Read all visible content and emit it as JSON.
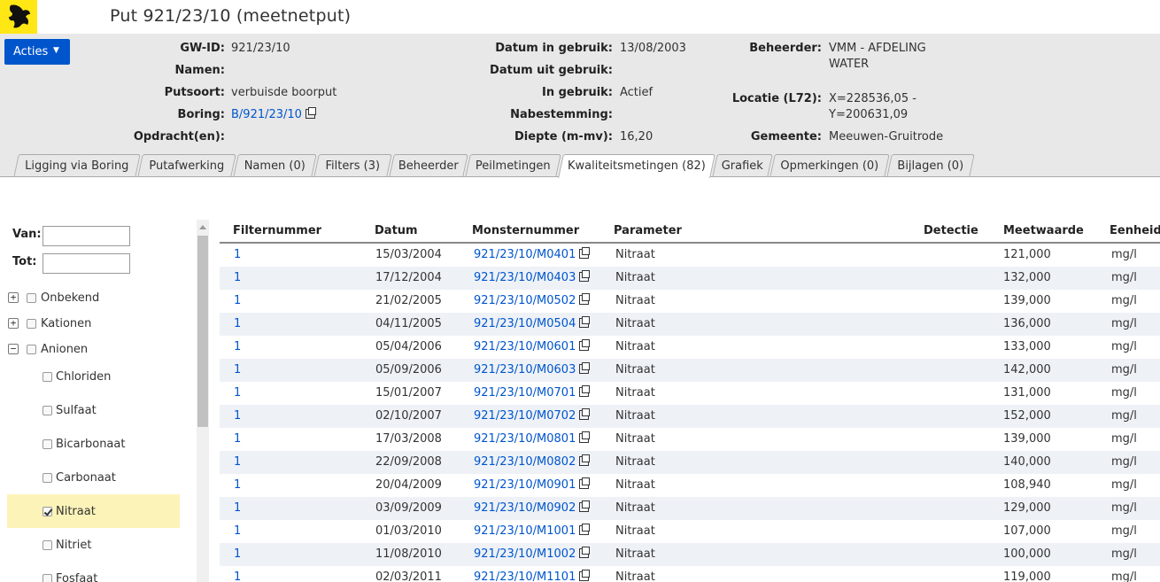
{
  "title": "Put 921/23/10 (meetnetput)",
  "actions_label": "Acties",
  "info": {
    "col1": [
      {
        "label": "GW-ID:",
        "value": "921/23/10"
      },
      {
        "label": "Namen:",
        "value": ""
      },
      {
        "label": "Putsoort:",
        "value": "verbuisde boorput"
      },
      {
        "label": "Boring:",
        "value": "B/921/23/10"
      },
      {
        "label": "Opdracht(en):",
        "value": ""
      }
    ],
    "col2": [
      {
        "label": "Datum in gebruik:",
        "value": "13/08/2003"
      },
      {
        "label": "Datum uit gebruik:",
        "value": ""
      },
      {
        "label": "In gebruik:",
        "value": "Actief"
      },
      {
        "label": "Nabestemming:",
        "value": ""
      },
      {
        "label": "Diepte (m-mv):",
        "value": "16,20"
      }
    ],
    "col3": {
      "beheerder_label": "Beheerder:",
      "beheerder_line1": "VMM - AFDELING",
      "beheerder_line2": "WATER",
      "locatie_label": "Locatie (L72):",
      "locatie_line1": "X=228536,05 -",
      "locatie_line2": "Y=200631,09",
      "gemeente_label": "Gemeente:",
      "gemeente_value": "Meeuwen-Gruitrode"
    }
  },
  "tabs": [
    {
      "label": "Ligging via Boring",
      "active": false
    },
    {
      "label": "Putafwerking",
      "active": false
    },
    {
      "label": "Namen (0)",
      "active": false
    },
    {
      "label": "Filters (3)",
      "active": false
    },
    {
      "label": "Beheerder",
      "active": false
    },
    {
      "label": "Peilmetingen",
      "active": false
    },
    {
      "label": "Kwaliteitsmetingen (82)",
      "active": true
    },
    {
      "label": "Grafiek",
      "active": false
    },
    {
      "label": "Opmerkingen (0)",
      "active": false
    },
    {
      "label": "Bijlagen (0)",
      "active": false
    }
  ],
  "filters": {
    "van_label": "Van:",
    "tot_label": "Tot:",
    "van_value": "",
    "tot_value": "",
    "groups": [
      {
        "label": "Onbekend",
        "expander": "+",
        "checked": false
      },
      {
        "label": "Kationen",
        "expander": "+",
        "checked": false
      },
      {
        "label": "Anionen",
        "expander": "−",
        "checked": false
      }
    ],
    "anionen_children": [
      {
        "label": "Chloriden",
        "checked": false
      },
      {
        "label": "Sulfaat",
        "checked": false
      },
      {
        "label": "Bicarbonaat",
        "checked": false
      },
      {
        "label": "Carbonaat",
        "checked": false
      },
      {
        "label": "Nitraat",
        "checked": true
      },
      {
        "label": "Nitriet",
        "checked": false
      },
      {
        "label": "Fosfaat",
        "checked": false
      }
    ]
  },
  "table": {
    "headers": {
      "filternummer": "Filternummer",
      "datum": "Datum",
      "monsternummer": "Monsternummer",
      "parameter": "Parameter",
      "detectie": "Detectie",
      "meetwaarde": "Meetwaarde",
      "eenheid": "Eenheid"
    },
    "rows": [
      {
        "filter": "1",
        "datum": "15/03/2004",
        "monster": "921/23/10/M0401",
        "parameter": "Nitraat",
        "detectie": "",
        "meetwaarde": "121,000",
        "eenheid": "mg/l"
      },
      {
        "filter": "1",
        "datum": "17/12/2004",
        "monster": "921/23/10/M0403",
        "parameter": "Nitraat",
        "detectie": "",
        "meetwaarde": "132,000",
        "eenheid": "mg/l"
      },
      {
        "filter": "1",
        "datum": "21/02/2005",
        "monster": "921/23/10/M0502",
        "parameter": "Nitraat",
        "detectie": "",
        "meetwaarde": "139,000",
        "eenheid": "mg/l"
      },
      {
        "filter": "1",
        "datum": "04/11/2005",
        "monster": "921/23/10/M0504",
        "parameter": "Nitraat",
        "detectie": "",
        "meetwaarde": "136,000",
        "eenheid": "mg/l"
      },
      {
        "filter": "1",
        "datum": "05/04/2006",
        "monster": "921/23/10/M0601",
        "parameter": "Nitraat",
        "detectie": "",
        "meetwaarde": "133,000",
        "eenheid": "mg/l"
      },
      {
        "filter": "1",
        "datum": "05/09/2006",
        "monster": "921/23/10/M0603",
        "parameter": "Nitraat",
        "detectie": "",
        "meetwaarde": "142,000",
        "eenheid": "mg/l"
      },
      {
        "filter": "1",
        "datum": "15/01/2007",
        "monster": "921/23/10/M0701",
        "parameter": "Nitraat",
        "detectie": "",
        "meetwaarde": "131,000",
        "eenheid": "mg/l"
      },
      {
        "filter": "1",
        "datum": "02/10/2007",
        "monster": "921/23/10/M0702",
        "parameter": "Nitraat",
        "detectie": "",
        "meetwaarde": "152,000",
        "eenheid": "mg/l"
      },
      {
        "filter": "1",
        "datum": "17/03/2008",
        "monster": "921/23/10/M0801",
        "parameter": "Nitraat",
        "detectie": "",
        "meetwaarde": "139,000",
        "eenheid": "mg/l"
      },
      {
        "filter": "1",
        "datum": "22/09/2008",
        "monster": "921/23/10/M0802",
        "parameter": "Nitraat",
        "detectie": "",
        "meetwaarde": "140,000",
        "eenheid": "mg/l"
      },
      {
        "filter": "1",
        "datum": "20/04/2009",
        "monster": "921/23/10/M0901",
        "parameter": "Nitraat",
        "detectie": "",
        "meetwaarde": "108,940",
        "eenheid": "mg/l"
      },
      {
        "filter": "1",
        "datum": "03/09/2009",
        "monster": "921/23/10/M0902",
        "parameter": "Nitraat",
        "detectie": "",
        "meetwaarde": "129,000",
        "eenheid": "mg/l"
      },
      {
        "filter": "1",
        "datum": "01/03/2010",
        "monster": "921/23/10/M1001",
        "parameter": "Nitraat",
        "detectie": "",
        "meetwaarde": "107,000",
        "eenheid": "mg/l"
      },
      {
        "filter": "1",
        "datum": "11/08/2010",
        "monster": "921/23/10/M1002",
        "parameter": "Nitraat",
        "detectie": "",
        "meetwaarde": "100,000",
        "eenheid": "mg/l"
      },
      {
        "filter": "1",
        "datum": "02/03/2011",
        "monster": "921/23/10/M1101",
        "parameter": "Nitraat",
        "detectie": "",
        "meetwaarde": "119,000",
        "eenheid": "mg/l"
      }
    ]
  },
  "colors": {
    "brand_yellow": "#ffe615",
    "link_blue": "#0055cc",
    "panel_gray": "#e8e8e8",
    "row_alt": "#eef2f7",
    "highlight": "#fcf3b8"
  }
}
